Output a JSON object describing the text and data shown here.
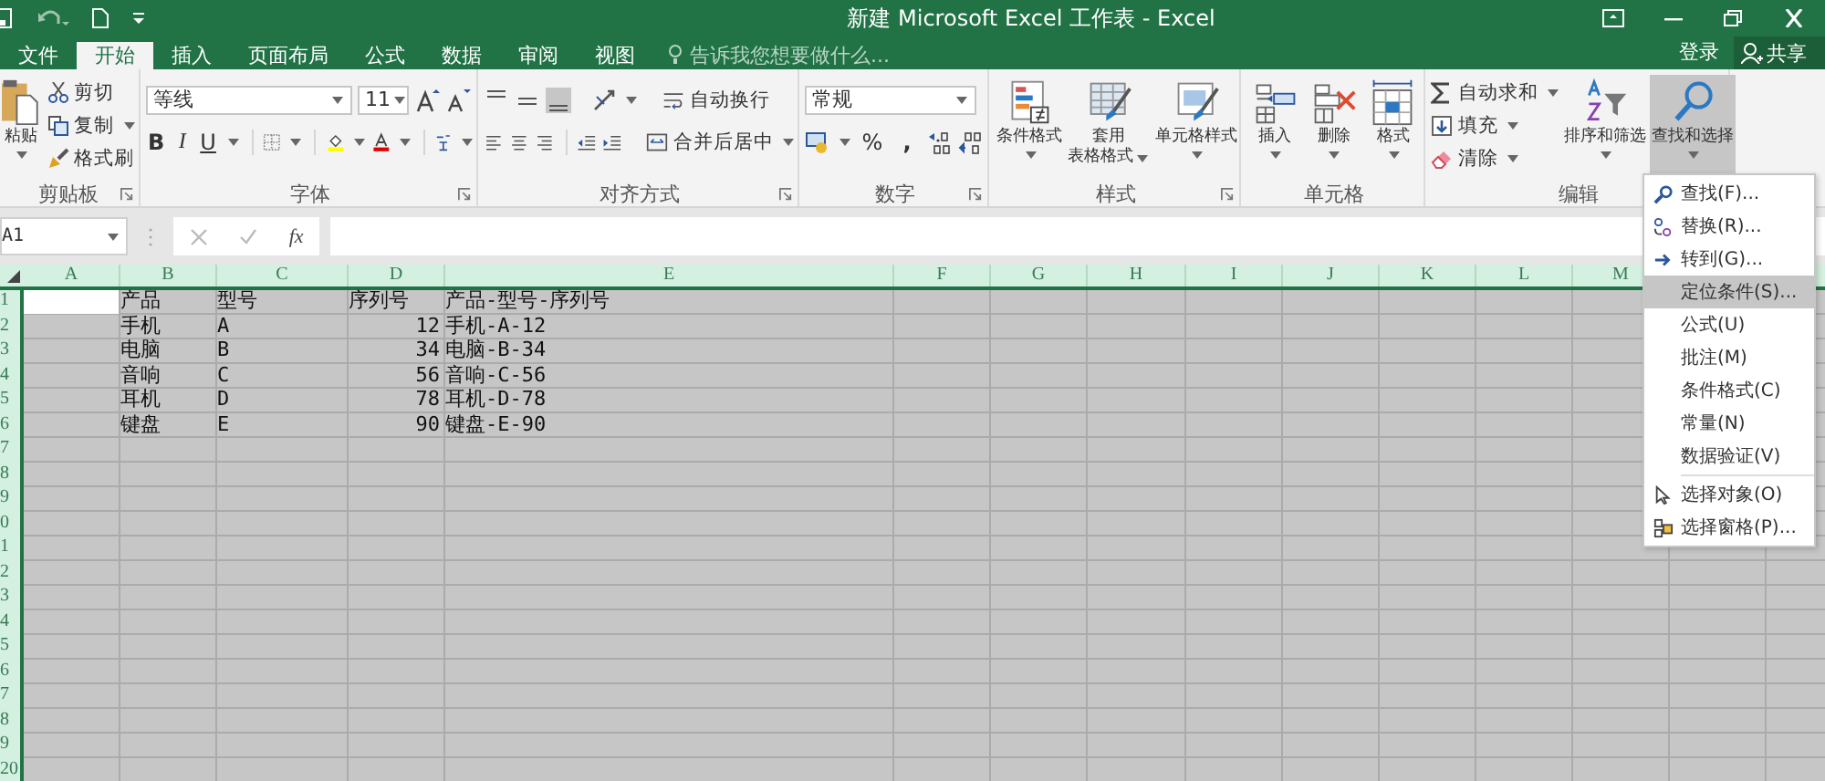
{
  "title_bar": {
    "title": "新建 Microsoft Excel 工作表 - Excel"
  },
  "tabs": [
    {
      "label": "文件",
      "selected": false
    },
    {
      "label": "开始",
      "selected": true
    },
    {
      "label": "插入",
      "selected": false
    },
    {
      "label": "页面布局",
      "selected": false
    },
    {
      "label": "公式",
      "selected": false
    },
    {
      "label": "数据",
      "selected": false
    },
    {
      "label": "审阅",
      "selected": false
    },
    {
      "label": "视图",
      "selected": false
    }
  ],
  "tell_me": {
    "placeholder": "告诉我您想要做什么..."
  },
  "sign_in": "登录",
  "share": "共享",
  "ribbon": {
    "clipboard": {
      "label": "剪贴板",
      "paste": "粘贴",
      "cut": "剪切",
      "copy": "复制",
      "format_painter": "格式刷"
    },
    "font": {
      "label": "字体",
      "font_name": "等线",
      "font_size": "11",
      "bold": "B",
      "italic": "I",
      "underline": "U"
    },
    "alignment": {
      "label": "对齐方式",
      "vertical": [
        {
          "kind": "top",
          "selected": false
        },
        {
          "kind": "middle",
          "selected": false
        },
        {
          "kind": "bottom",
          "selected": true
        }
      ],
      "wrap_text": "自动换行",
      "merge_center": "合并后居中"
    },
    "number": {
      "label": "数字",
      "format": "常规",
      "percent": "%",
      "comma": ","
    },
    "styles": {
      "label": "样式",
      "conditional": "条件格式",
      "table_format": [
        "套用",
        "表格格式"
      ],
      "cell_styles": "单元格样式"
    },
    "cells": {
      "label": "单元格",
      "insert": "插入",
      "delete": "删除",
      "format": "格式"
    },
    "editing": {
      "label": "编辑",
      "autosum": "自动求和",
      "fill": "填充",
      "clear": "清除",
      "sort_filter": "排序和筛选",
      "find_select": {
        "label": "查找和选择",
        "selected": true
      }
    }
  },
  "name_box": "A1",
  "function_label": "fx",
  "sheet": {
    "all_selected": true,
    "columns": [
      "A",
      "B",
      "C",
      "D",
      "E",
      "F",
      "G",
      "H",
      "I",
      "J",
      "K",
      "L",
      "M"
    ],
    "rows": [
      {
        "number": "1",
        "cells": {
          "A": {
            "active": true
          },
          "B": {
            "text": "产品"
          },
          "C": {
            "text": "型号"
          },
          "D": {
            "text": "序列号"
          },
          "E": {
            "text": "产品-型号-序列号"
          }
        }
      },
      {
        "number": "2",
        "cells": {
          "B": {
            "text": "手机"
          },
          "C": {
            "text": "A"
          },
          "D": {
            "text": "12",
            "kind": "number"
          },
          "E": {
            "text": "手机-A-12"
          }
        }
      },
      {
        "number": "3",
        "cells": {
          "B": {
            "text": "电脑"
          },
          "C": {
            "text": "B"
          },
          "D": {
            "text": "34",
            "kind": "number"
          },
          "E": {
            "text": "电脑-B-34"
          }
        }
      },
      {
        "number": "4",
        "cells": {
          "B": {
            "text": "音响"
          },
          "C": {
            "text": "C"
          },
          "D": {
            "text": "56",
            "kind": "number"
          },
          "E": {
            "text": "音响-C-56"
          }
        }
      },
      {
        "number": "5",
        "cells": {
          "B": {
            "text": "耳机"
          },
          "C": {
            "text": "D"
          },
          "D": {
            "text": "78",
            "kind": "number"
          },
          "E": {
            "text": "耳机-D-78"
          }
        }
      },
      {
        "number": "6",
        "cells": {
          "B": {
            "text": "键盘"
          },
          "C": {
            "text": "E"
          },
          "D": {
            "text": "90",
            "kind": "number"
          },
          "E": {
            "text": "键盘-E-90"
          }
        }
      },
      {
        "number": "7"
      },
      {
        "number": "8"
      },
      {
        "number": "9"
      },
      {
        "number": "0"
      },
      {
        "number": "1"
      },
      {
        "number": "2"
      },
      {
        "number": "3"
      },
      {
        "number": "4"
      },
      {
        "number": "5"
      },
      {
        "number": "6"
      },
      {
        "number": "7"
      },
      {
        "number": "8"
      },
      {
        "number": "9"
      },
      {
        "number": "20"
      }
    ]
  },
  "find_menu": {
    "items": [
      {
        "label": "查找(F)...",
        "kind": "find",
        "selected": false
      },
      {
        "label": "替换(R)...",
        "kind": "replace",
        "selected": false
      },
      {
        "label": "转到(G)...",
        "kind": "goto",
        "selected": false
      },
      {
        "label": "定位条件(S)...",
        "kind": "plain",
        "selected": true
      },
      {
        "label": "公式(U)",
        "kind": "plain",
        "selected": false
      },
      {
        "label": "批注(M)",
        "kind": "plain",
        "selected": false
      },
      {
        "label": "条件格式(C)",
        "kind": "plain",
        "selected": false
      },
      {
        "label": "常量(N)",
        "kind": "plain",
        "selected": false
      },
      {
        "label": "数据验证(V)",
        "kind": "plain",
        "selected": false
      },
      {
        "kind": "separator"
      },
      {
        "label": "选择对象(O)",
        "kind": "select_objects",
        "selected": false
      },
      {
        "label": "选择窗格(P)...",
        "kind": "selection_pane",
        "selected": false
      }
    ]
  }
}
